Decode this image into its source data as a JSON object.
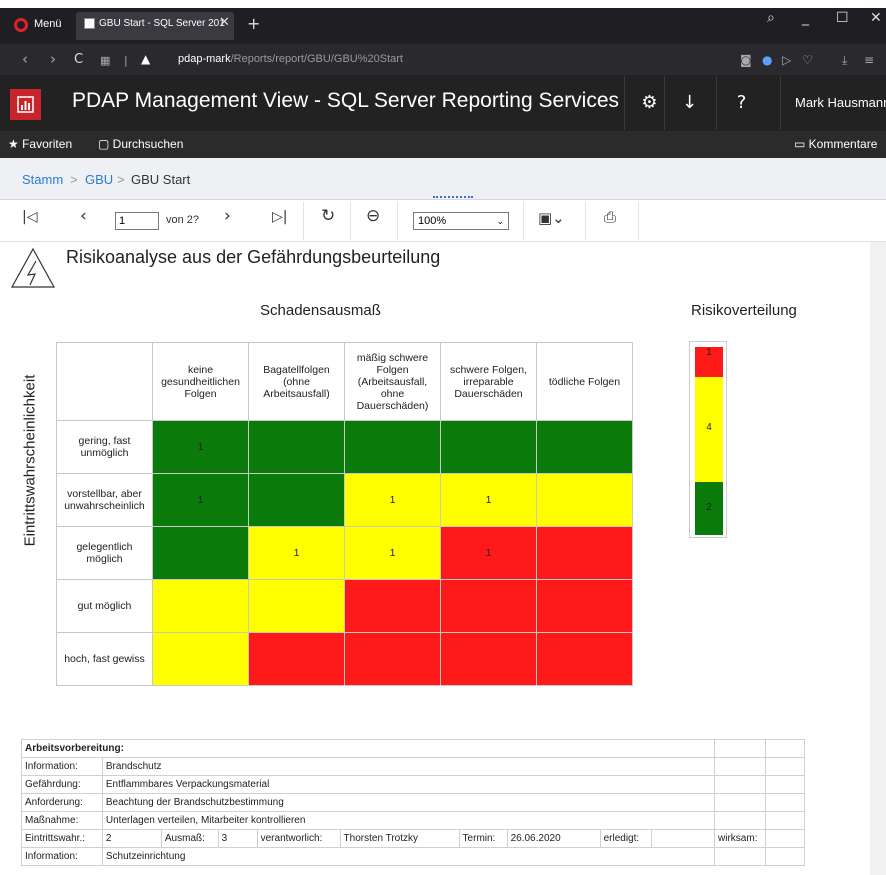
{
  "browser": {
    "menu_label": "Menü",
    "tab_title": "GBU Start - SQL Server 201",
    "tab_close": "✕",
    "new_tab": "+",
    "url_host": "pdap-mark",
    "url_path": "/Reports/report/GBU/GBU%20Start"
  },
  "app": {
    "title": "PDAP Management View - SQL Server Reporting Services",
    "user": "Mark Hausmann",
    "settings_glyph": "⚙",
    "download_glyph": "↓",
    "help_glyph": "?",
    "favorites_label": "Favoriten",
    "browse_label": "Durchsuchen",
    "comments_label": "Kommentare"
  },
  "breadcrumb": {
    "items": [
      "Stamm",
      "GBU",
      "GBU Start"
    ],
    "separator": ">"
  },
  "toolbar": {
    "page_value": "1",
    "of_label": "von 2?",
    "zoom_value": "100%"
  },
  "report": {
    "title": "Risikoanalyse aus der Gefährdungsbeurteilung",
    "x_axis_title": "Schadensausmaß",
    "y_axis_title": "Eintrittswahrscheinlichkeit",
    "distribution_title": "Risikoverteilung",
    "columns": [
      "keine gesundheitlichen Folgen",
      "Bagatellfolgen (ohne Arbeitsausfall)",
      "mäßig schwere Folgen (Arbeitsausfall, ohne Dauerschäden)",
      "schwere Folgen, irreparable Dauerschäden",
      "tödliche Folgen"
    ],
    "rows": [
      {
        "label": "gering, fast unmöglich",
        "cells": [
          {
            "c": "green",
            "v": "1"
          },
          {
            "c": "green",
            "v": ""
          },
          {
            "c": "green",
            "v": ""
          },
          {
            "c": "green",
            "v": ""
          },
          {
            "c": "green",
            "v": ""
          }
        ]
      },
      {
        "label": "vorstellbar, aber unwahrscheinlich",
        "cells": [
          {
            "c": "green",
            "v": "1"
          },
          {
            "c": "green",
            "v": ""
          },
          {
            "c": "yellow",
            "v": "1"
          },
          {
            "c": "yellow",
            "v": "1"
          },
          {
            "c": "yellow",
            "v": ""
          }
        ]
      },
      {
        "label": "gelegentlich möglich",
        "cells": [
          {
            "c": "green",
            "v": ""
          },
          {
            "c": "yellow",
            "v": "1"
          },
          {
            "c": "yellow",
            "v": "1"
          },
          {
            "c": "red",
            "v": "1"
          },
          {
            "c": "red",
            "v": ""
          }
        ]
      },
      {
        "label": "gut möglich",
        "cells": [
          {
            "c": "yellow",
            "v": ""
          },
          {
            "c": "yellow",
            "v": ""
          },
          {
            "c": "red",
            "v": ""
          },
          {
            "c": "red",
            "v": ""
          },
          {
            "c": "red",
            "v": ""
          }
        ]
      },
      {
        "label": "hoch, fast gewiss",
        "cells": [
          {
            "c": "yellow",
            "v": ""
          },
          {
            "c": "red",
            "v": ""
          },
          {
            "c": "red",
            "v": ""
          },
          {
            "c": "red",
            "v": ""
          },
          {
            "c": "red",
            "v": ""
          }
        ]
      }
    ],
    "distribution": [
      {
        "color": "red",
        "count": "1"
      },
      {
        "color": "yellow",
        "count": "4"
      },
      {
        "color": "green",
        "count": "2"
      }
    ],
    "colors": {
      "green": "#0a7a0a",
      "yellow": "#ffff00",
      "red": "#ff1a1a"
    }
  },
  "details": {
    "section": "Arbeitsvorbereitung:",
    "info_label": "Information:",
    "info_value": "Brandschutz",
    "hazard_label": "Gefährdung:",
    "hazard_value": "Entflammbares Verpackungsmaterial",
    "requirement_label": "Anforderung:",
    "requirement_value": "Beachtung der Brandschutzbestimmung",
    "measure_label": "Maßnahme:",
    "measure_value": "Unterlagen verteilen, Mitarbeiter kontrollieren",
    "prob_label": "Eintrittswahr.:",
    "prob_value": "2",
    "extent_label": "Ausmaß:",
    "extent_value": "3",
    "resp_label": "verantworlich:",
    "resp_value": "Thorsten Trotzky",
    "date_label": "Termin:",
    "date_value": "26.06.2020",
    "done_label": "erledigt:",
    "effective_label": "wirksam:",
    "info2_label": "Information:",
    "info2_value": "Schutzeinrichtung"
  }
}
